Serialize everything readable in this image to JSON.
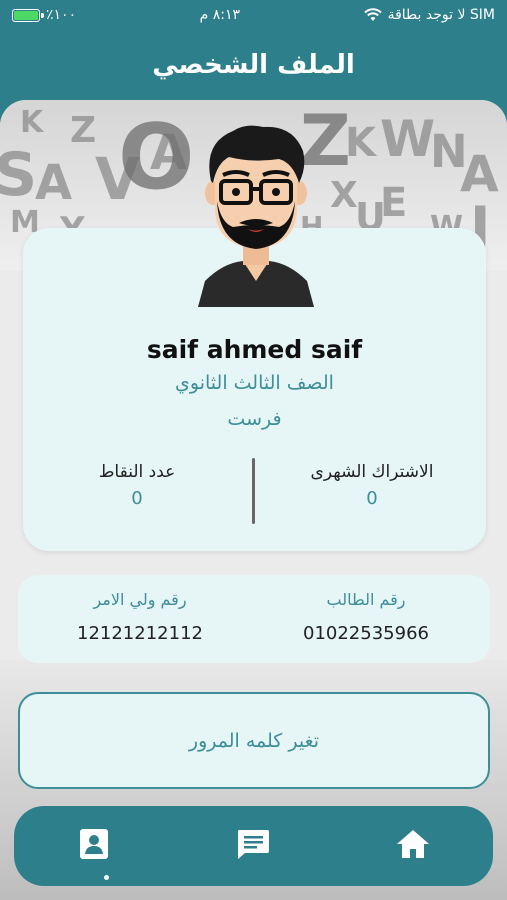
{
  "status_bar": {
    "carrier": "لا توجد بطاقة SIM",
    "time": "٨:١٣ م",
    "battery": "٪١٠٠",
    "battery_level": 1.0
  },
  "header": {
    "title": "الملف الشخصي"
  },
  "profile": {
    "name": "saif ahmed saif",
    "grade": "الصف الثالث الثانوي",
    "branch": "فرست",
    "monthly_subscription_label": "الاشتراك الشهرى",
    "monthly_subscription_value": "0",
    "points_label": "عدد النقاط",
    "points_value": "0"
  },
  "ids": {
    "student_label": "رقم الطالب",
    "student_value": "01022535966",
    "parent_label": "رقم ولي الامر",
    "parent_value": "12121212112"
  },
  "change_password_label": "تغير كلمه المرور",
  "bottom_nav": {
    "items": [
      "home-icon",
      "chat-icon",
      "profile-icon"
    ],
    "active": "profile-icon"
  },
  "colors": {
    "primary": "#2e7f8c",
    "card": "#e6f5f6",
    "accent_text": "#3e8e9a"
  }
}
